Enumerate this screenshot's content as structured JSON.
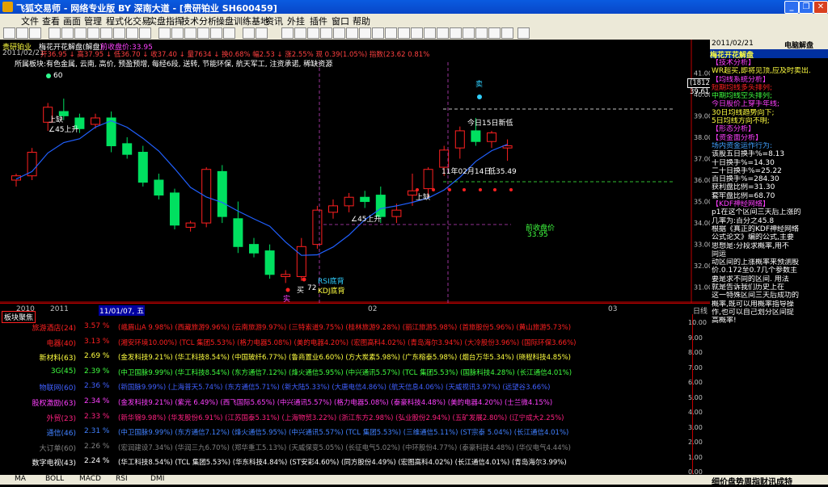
{
  "window": {
    "title": "飞狐交易师 - 网络专业版 BY 深南大道 - [贵研铂业 SH600459]",
    "buttons": [
      "_",
      "❐",
      "✕"
    ]
  },
  "menu": [
    "文件",
    "查看",
    "画面",
    "管理",
    "程式化交易",
    "实盘指挥",
    "技术分析",
    "操盘训练基地",
    "资讯",
    "外挂",
    "插件",
    "窗口",
    "帮助"
  ],
  "chart": {
    "stock_name": "贵研铂业",
    "indicator_name": "梅花开花解盘(解盘)",
    "header_tail": "前收盘价:33.95",
    "stat_line": "开36.95 ↓ 高37.95 ↓ 低36.70 ↓ 收37.40 ↓ 量7634 ↓ 换0.68% 幅2.53 ↓ 涨2.55% 现 0.39(1.05%) 指数(23.62 0.81%",
    "date_label": "2011/02/21",
    "sector_line": "所属板块:有色金属, 云南, 高价, 预盈预增, 每经6段, 送转, 节能环保, 航天军工, 注资承诺, 稀缺资源",
    "y_ticks": [
      "41.00",
      "40.00",
      "39.00",
      "38.00",
      "37.00",
      "36.00",
      "35.00",
      "34.00",
      "33.00",
      "32.00",
      "31.00"
    ],
    "price_box": [
      "(1812)",
      "39.61"
    ],
    "annotations": {
      "a60": "60",
      "shangque": "上缺",
      "up45": "∠45上升",
      "sell": "卖",
      "jin15": "今日15日新低",
      "date_low": "11年02月14日",
      "low_val": "低35.49",
      "shangque2": "上缺",
      "up45b": "∠45上升",
      "prev_close_label": "前收盘价",
      "prev_close_val": "33.95",
      "buy": "买",
      "val72": "72",
      "rsi": "RSI底背",
      "kdj": "KDJ底背",
      "shi": "实"
    },
    "chart_data": {
      "type": "candlestick",
      "title": "梅花开花解盘(解盘)",
      "ylim": [
        30.5,
        41.5
      ],
      "candles": [
        {
          "o": 36.0,
          "h": 36.3,
          "l": 35.7,
          "c": 36.2,
          "color": "red"
        },
        {
          "o": 36.2,
          "h": 37.5,
          "l": 36.0,
          "c": 37.3,
          "color": "red"
        },
        {
          "o": 38.7,
          "h": 39.6,
          "l": 38.3,
          "c": 39.4,
          "color": "red"
        },
        {
          "o": 39.2,
          "h": 39.8,
          "l": 38.8,
          "c": 39.0,
          "color": "green"
        },
        {
          "o": 38.9,
          "h": 39.1,
          "l": 38.2,
          "c": 38.4,
          "color": "green"
        },
        {
          "o": 38.6,
          "h": 39.1,
          "l": 38.4,
          "c": 38.9,
          "color": "red"
        },
        {
          "o": 38.9,
          "h": 39.2,
          "l": 37.3,
          "c": 37.6,
          "color": "green"
        },
        {
          "o": 37.7,
          "h": 38.0,
          "l": 37.0,
          "c": 37.2,
          "color": "green"
        },
        {
          "o": 37.3,
          "h": 37.6,
          "l": 35.7,
          "c": 35.9,
          "color": "green"
        },
        {
          "o": 36.0,
          "h": 36.3,
          "l": 35.1,
          "c": 35.3,
          "color": "green"
        },
        {
          "o": 35.4,
          "h": 35.6,
          "l": 33.7,
          "c": 33.9,
          "color": "green"
        },
        {
          "o": 33.8,
          "h": 34.1,
          "l": 33.6,
          "c": 34.0,
          "color": "red"
        },
        {
          "o": 34.0,
          "h": 36.6,
          "l": 33.8,
          "c": 36.5,
          "color": "red"
        },
        {
          "o": 36.4,
          "h": 36.7,
          "l": 34.0,
          "c": 34.3,
          "color": "green"
        },
        {
          "o": 34.2,
          "h": 35.0,
          "l": 32.6,
          "c": 32.9,
          "color": "green"
        },
        {
          "o": 33.0,
          "h": 33.3,
          "l": 32.4,
          "c": 32.6,
          "color": "green"
        },
        {
          "o": 32.7,
          "h": 33.0,
          "l": 31.4,
          "c": 31.6,
          "color": "green"
        },
        {
          "o": 31.6,
          "h": 31.8,
          "l": 31.2,
          "c": 31.5,
          "color": "red"
        },
        {
          "o": 31.5,
          "h": 33.3,
          "l": 31.3,
          "c": 32.9,
          "color": "red"
        },
        {
          "o": 33.0,
          "h": 34.8,
          "l": 32.8,
          "c": 34.6,
          "color": "red"
        },
        {
          "o": 34.5,
          "h": 35.1,
          "l": 34.2,
          "c": 34.8,
          "color": "red"
        },
        {
          "o": 34.8,
          "h": 35.4,
          "l": 34.5,
          "c": 35.2,
          "color": "red"
        },
        {
          "o": 35.2,
          "h": 35.5,
          "l": 34.7,
          "c": 35.0,
          "color": "green"
        },
        {
          "o": 35.3,
          "h": 35.7,
          "l": 34.0,
          "c": 34.3,
          "color": "green"
        },
        {
          "o": 34.3,
          "h": 34.9,
          "l": 34.0,
          "c": 34.6,
          "color": "red"
        },
        {
          "o": 35.3,
          "h": 36.3,
          "l": 34.8,
          "c": 35.5,
          "color": "red"
        },
        {
          "o": 35.6,
          "h": 36.6,
          "l": 35.2,
          "c": 36.5,
          "color": "red"
        },
        {
          "o": 36.6,
          "h": 37.6,
          "l": 36.2,
          "c": 37.4,
          "color": "red"
        },
        {
          "o": 37.5,
          "h": 38.5,
          "l": 37.0,
          "c": 38.3,
          "color": "red"
        },
        {
          "o": 38.3,
          "h": 38.9,
          "l": 37.6,
          "c": 37.8,
          "color": "green"
        },
        {
          "o": 37.8,
          "h": 38.3,
          "l": 37.5,
          "c": 38.2,
          "color": "red"
        },
        {
          "o": 37.6,
          "h": 37.9,
          "l": 36.9,
          "c": 37.5,
          "color": "red"
        }
      ]
    }
  },
  "lower": {
    "year_label": "2010",
    "year_label2": "2011",
    "date_cursor": "11/01/07, 五",
    "month_02": "02",
    "month_03": "03",
    "axis_label": "日线",
    "panel_button": "板块聚焦",
    "y_ticks": [
      "10.00",
      "9.00",
      "8.00",
      "7.00",
      "6.00",
      "5.00",
      "4.00",
      "3.00",
      "2.00",
      "1.00",
      "0.00"
    ],
    "rows": [
      {
        "name": "旅游酒店(24)",
        "pct": "3.57 %",
        "stocks": "(峨眉山A 9.98%)  (西藏旅游9.96%)  (云南旅游9.97%)  (三特索道9.75%)  (桂林旅游9.28%)  (丽江旅游5.98%)  (首旅股份5.96%)  (黄山旅游5.73%)",
        "color": "#ff2020"
      },
      {
        "name": "电器(40)",
        "pct": "3.13 %",
        "stocks": "(湘安环境10.00%)  (TCL 集团5.53%)  (格力电器5.08%)  (美的电器4.20%)  (宏图高科4.02%)  (青岛海尔3.94%)  (大冷股份3.96%)  (国际环保3.66%)",
        "color": "#ff2020"
      },
      {
        "name": "新材料(63)",
        "pct": "2.69 %",
        "stocks": "(金发科技9.21%)  (华工科技8.54%)  (中国玻纤6.77%)  (鲁商置业6.60%)  (方大炭素5.98%)  (广东榕泰5.98%)  (烟台万华5.34%)  (晓程科技4.85%)",
        "color": "#ffff40"
      },
      {
        "name": "3G(45)",
        "pct": "2.39 %",
        "stocks": "(中卫国脉9.99%)  (华工科技8.54%)  (东方通信7.12%)  (烽火通信5.95%)  (中兴通讯5.57%)  (TCL 集团5.53%)  (国脉科技4.28%)  (长江通信4.01%)",
        "color": "#40ff40"
      },
      {
        "name": "物联网(60)",
        "pct": "2.36 %",
        "stocks": "(新国脉9.99%)  (上海普天5.74%)  (东方通信5.71%)  (新大陆5.33%)  (大唐电信4.86%)  (航天信息4.06%)  (天威视讯3.97%)  (远望谷3.66%)",
        "color": "#4060ff"
      },
      {
        "name": "股权激励(63)",
        "pct": "2.34 %",
        "stocks": "(金发科技9.21%)  (紫光 6.49%)  (西飞国际5.65%)  (中兴通讯5.57%)  (格力电器5.08%)  (泰豪科技4.48%)  (美的电器4.20%)  (士兰微4.15%)",
        "color": "#ff40ff"
      },
      {
        "name": "外贸(23)",
        "pct": "2.33 %",
        "stocks": "(新华锦9.98%)  (华发股份6.91%)  (江苏国泰5.31%)  (上海物贸3.22%)  (浙江东方2.98%)  (弘业股份2.94%)  (五矿发展2.80%)  (辽宁成大2.25%)",
        "color": "#ff2080"
      },
      {
        "name": "通信(46)",
        "pct": "2.31 %",
        "stocks": "(中卫国脉9.99%)  (东方通信7.12%)  (烽火通信5.95%)  (中兴通讯5.57%)  (TCL 集团5.53%)  (三维通信5.11%)  (ST宗泰 5.04%)  (长江通信4.01%)",
        "color": "#4080ff"
      },
      {
        "name": "大订单(60)",
        "pct": "2.26 %",
        "stocks": "(宏润建设7.34%)  (华润三九6.70%)  (郑华重工5.13%)  (天威保变5.05%)  (长征电气5.02%)  (中环股份4.77%)  (泰豪科技4.48%)  (华仪电气4.44%)",
        "color": "#808080"
      },
      {
        "name": "数字电视(43)",
        "pct": "2.24 %",
        "stocks": "(华工科技8.54%)  (TCL 集团5.53%)  (华东科技4.84%)  (ST安彩4.60%)  (同方股份4.49%)  (宏图高科4.02%)  (长江通信4.01%)  (青岛海尔3.99%)",
        "color": "#ffffff"
      }
    ]
  },
  "rightpanel": {
    "date": "2011/02/21",
    "mode": "电脑解盘",
    "title": "梅花开花解盘",
    "lines": [
      {
        "text": "【技术分析】",
        "color": "#ff40ff"
      },
      {
        "text": "WR超买,即将见顶,应及时卖出.",
        "color": "#ffff40"
      },
      {
        "text": "【均线系统分析】",
        "color": "#ff40ff"
      },
      {
        "text": "短期均线多头排列;",
        "color": "#ff2020"
      },
      {
        "text": "中期均线空头排列;",
        "color": "#40ff40"
      },
      {
        "text": "今日股价上穿手年线;",
        "color": "#ff40ff"
      },
      {
        "text": "30日均线趋势向下;",
        "color": "#ffff40"
      },
      {
        "text": "5日均线方向不明;",
        "color": "#ffff40"
      },
      {
        "text": "【形态分析】",
        "color": "#ff40ff"
      },
      {
        "text": "【资金面分析】",
        "color": "#ff40ff"
      },
      {
        "text": "场内资金运作行为:",
        "color": "#40a0ff"
      },
      {
        "text": "该股五日换手%=8.13",
        "color": "#ffffff"
      },
      {
        "text": "十日换手%=14.30",
        "color": "#ffffff"
      },
      {
        "text": "二十日换手%=25.22",
        "color": "#ffffff"
      },
      {
        "text": "百日换手%=284.30",
        "color": "#ffffff"
      },
      {
        "text": "获利盘比例=31.30",
        "color": "#ffffff"
      },
      {
        "text": "套牢盘比例=68.70",
        "color": "#ffffff"
      },
      {
        "text": "【KDF神经网络】",
        "color": "#ff40ff"
      },
      {
        "text": "p1在这个区间三天后上涨的",
        "color": "#ffffff"
      },
      {
        "text": "几率为:百分之45.8",
        "color": "#ffffff"
      },
      {
        "text": "根据《真正的KDF神经网络",
        "color": "#ffffff"
      },
      {
        "text": "公式论文》编的公式,主要",
        "color": "#ffffff"
      },
      {
        "text": "思想是:分段求概率,用不",
        "color": "#ffffff"
      },
      {
        "text": "同运",
        "color": "#ffffff"
      },
      {
        "text": "动区间的上涨概率来预测股",
        "color": "#ffffff"
      },
      {
        "text": "价.0.172至0.7几个参数主",
        "color": "#ffffff"
      },
      {
        "text": "要是求不同的区间. 用法",
        "color": "#ffffff"
      },
      {
        "text": "就是告诉我们历史上在",
        "color": "#ffffff"
      },
      {
        "text": "这一特殊区间三天后成功的",
        "color": "#ffffff"
      },
      {
        "text": "概率,既可以用概率指导操",
        "color": "#ffffff"
      },
      {
        "text": "作,也可以自己划分区间提",
        "color": "#ffffff"
      },
      {
        "text": "高概率!",
        "color": "#ffffff"
      }
    ]
  },
  "bottom_tabs": [
    "MA",
    "BOLL",
    "MACD",
    "RSI",
    "DMI"
  ],
  "status_right": "细价盘势周指财讯成特"
}
